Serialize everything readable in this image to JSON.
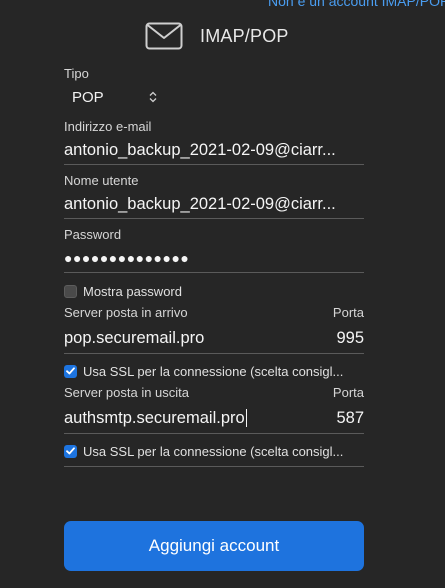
{
  "top_link": "Non è un account IMAP/POP?",
  "header": {
    "title": "IMAP/POP",
    "icon": "envelope-icon"
  },
  "form": {
    "tipo": {
      "label": "Tipo",
      "value": "POP"
    },
    "email": {
      "label": "Indirizzo e-mail",
      "value": "antonio_backup_2021-02-09@ciarr..."
    },
    "username": {
      "label": "Nome utente",
      "value": "antonio_backup_2021-02-09@ciarr..."
    },
    "password": {
      "label": "Password",
      "value": "●●●●●●●●●●●●●●"
    },
    "show_password": {
      "label": "Mostra password",
      "checked": false
    },
    "incoming": {
      "server_label": "Server posta in arrivo",
      "port_label": "Porta",
      "server": "pop.securemail.pro",
      "port": "995",
      "ssl_label": "Usa SSL per la connessione (scelta consigl...",
      "ssl_checked": true
    },
    "outgoing": {
      "server_label": "Server posta in uscita",
      "port_label": "Porta",
      "server": "authsmtp.securemail.pro",
      "port": "587",
      "ssl_label": "Usa SSL per la connessione (scelta consigl...",
      "ssl_checked": true
    }
  },
  "submit_button": "Aggiungi account",
  "colors": {
    "background": "#262626",
    "accent": "#1e73de",
    "link": "#4a9df0"
  }
}
